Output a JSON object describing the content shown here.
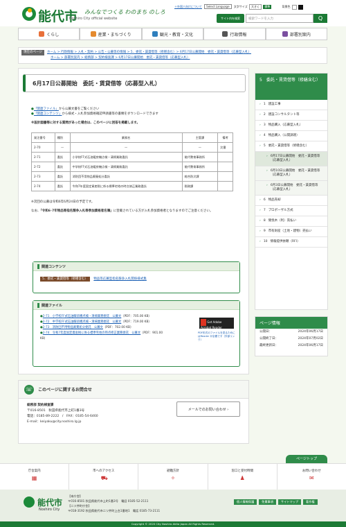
{
  "header": {
    "title": "能代市",
    "tagline": "みんなでつくる わのまち のしろ",
    "subtitle": "Noshiro City official website",
    "foreign": "＋外国人向けについて",
    "lang_select": "Select Language",
    "fontsize_label": "文字サイズ",
    "small": "大きく",
    "std": "標準",
    "bgcolor": "背景色",
    "sitewide": "サイト内を検索",
    "search_placeholder": "検索ワードを入力",
    "search_btn": "Q"
  },
  "nav": [
    {
      "label": "くらし",
      "color": "#e8703a"
    },
    {
      "label": "産業・まちづくり",
      "color": "#e58a2f"
    },
    {
      "label": "観光・教育・文化",
      "color": "#2f7fbd"
    },
    {
      "label": "行政情報",
      "color": "#555"
    },
    {
      "label": "部署別案内",
      "color": "#7b4fa0"
    }
  ],
  "breadcrumb": {
    "label": "現在のページ",
    "line1": "ホーム > 行政情報 > 入札・契約 > 公告・公募等の情報 > 5．委託・賃貸借等（修繕含む）> 6月17日公募開始　委託・賃貸借等（応募型入札）",
    "line2": "ホーム > 部署別案内 > 総務部 > 契約検査課 > 6月17日公募開始　委託・賃貸借等（応募型入札）"
  },
  "main": {
    "heading": "6月17日公募開始　委託・賃貸借等（応募型入札）",
    "p1a": "「関連ファイル」",
    "p1b": "から公募文書をご覧ください",
    "p2a": "「関連コンテンツ」",
    "p2b": "から様式・入札参加資格確認申請書等の書類をダウンロードできます",
    "bold": "※設計図書等に対する質問があった場合は、このページに回答を掲載します。",
    "table_headers": [
      "発注番号",
      "種別",
      "業務名",
      "主管課",
      "備考"
    ],
    "rows": [
      [
        "2-70",
        "—",
        "—",
        "—",
        "欠番"
      ],
      [
        "2-71",
        "委託",
        "小学校FF式石油暖房機点検・清掃業務委託",
        "能代教育事務所",
        ""
      ],
      [
        "2-72",
        "委託",
        "中学校FF式石油暖房機点検・清掃業務委託",
        "能代教育事務所",
        ""
      ],
      [
        "2-73",
        "委託",
        "消防団不用物品廃棄処分委託",
        "総合防災課",
        ""
      ],
      [
        "2-74",
        "委託",
        "令和7年度固定資産税に係る標準宅地の時点修正業務委託",
        "税務課",
        ""
      ]
    ],
    "note": "※次回の公募は令和6年6月24日の予定です。",
    "note2a": "なお、",
    "note2b": "「令和6･7年物品等指名競争入札等参加資格者名簿」",
    "note2c": "に登載されている方が入札参加資格者となりますのでご注意ください。"
  },
  "related_contents": {
    "title": "関連コンテンツ",
    "badge": "5．委託・賃貸借等（修繕含む）",
    "link": "物品等応募型指名競争入札関係様式集"
  },
  "related_files": {
    "title": "関連ファイル",
    "files": [
      {
        "name": "2-71　小学校FF式石油暖房機点検・清掃業務委託　公募文",
        "meta": "（PDF：705.00 KB）"
      },
      {
        "name": "2-72　中学校FF式石油暖房機点検・清掃業務委託　公募文",
        "meta": "（PDF：719.00 KB）"
      },
      {
        "name": "2-73　消防団不用物品廃棄処分委託　公募文",
        "meta": "（PDF：702.00 KB）"
      },
      {
        "name": "2-74　令和7年度固定資産税に係る標準宅地の時点修正業務委託　公募文",
        "meta": "（PDF：901.00 KB）"
      }
    ],
    "reader_alt": "Get Adobe Acrobat Reader",
    "reader_note": "PDF形式のファイルを見るためにはReader が必要です（外部リンク）"
  },
  "sidebar": {
    "head": "5　委託・賃貸借等（修繕含む）",
    "items": [
      {
        "n": "1",
        "label": "建設工事",
        "sub": false,
        "sel": false
      },
      {
        "n": "2",
        "label": "建設コンサルタント等",
        "sub": false,
        "sel": false
      },
      {
        "n": "3",
        "label": "物品購入（応募型入札）",
        "sub": false,
        "sel": false
      },
      {
        "n": "4",
        "label": "物品購入（公開調達）",
        "sub": false,
        "sel": false
      },
      {
        "n": "5",
        "label": "委託・賃貸借等（修繕含む）",
        "sub": false,
        "sel": false
      },
      {
        "n": "",
        "label": "6月17日公募開始　委託・賃貸借等（応募型入札）",
        "sub": true,
        "sel": true
      },
      {
        "n": "",
        "label": "6月10日公募開始　委託・賃貸借等（応募型入札）",
        "sub": true,
        "sel": false
      },
      {
        "n": "",
        "label": "6月3日公募開始　委託・賃貸借等（応募型入札）",
        "sub": true,
        "sel": false
      },
      {
        "n": "6",
        "label": "物品売却",
        "sub": false,
        "sel": false
      },
      {
        "n": "7",
        "label": "プロポーザル方式",
        "sub": false,
        "sel": false
      },
      {
        "n": "8",
        "label": "間伐木（利）売払い",
        "sub": false,
        "sel": false
      },
      {
        "n": "9",
        "label": "市有財産（土地・建物）売払い",
        "sub": false,
        "sel": false
      },
      {
        "n": "10",
        "label": "情報提供依頼（RFI）",
        "sub": false,
        "sel": false
      }
    ]
  },
  "pageinfo": {
    "title": "ページ情報",
    "rows": [
      [
        "公開日：",
        "2024年06月17日"
      ],
      [
        "公開終了日：",
        "2024年07月02日"
      ],
      [
        "最終更新日：",
        "2024年06月17日"
      ]
    ]
  },
  "contact": {
    "title": "このページに関するお問合せ",
    "dept": "総務部 契約検査課",
    "addr": "〒016-8501　秋田県能代市上町1番3号",
    "tel": "電話：0185-89-2222　/　FAX：0185-54-6460",
    "email": "E-mail：keiyaku@city.noshiro.lg.jp",
    "mail_btn": "メールでのお問い合わせ ›"
  },
  "pagetop": "ページトップ",
  "footer": {
    "items": [
      "庁舎案内",
      "市へのアクセス",
      "避難方針",
      "窓口と受付時間",
      "お問い合わせ"
    ],
    "title": "能代市",
    "sub": "Noshiro City",
    "addr1": "【本庁舎】",
    "addr2": "〒016-8501 秋田県能代市上町1番3号　電話 0185-52-2111",
    "addr3": "【二ツ井町庁舎】",
    "addr4": "〒018-3192 秋田県能代市二ツ井町上台1番地1　電話 0185-73-2111",
    "links": [
      "個人情報保護",
      "免責事項",
      "サイトマップ",
      "著作権"
    ],
    "copy": "Copyright © 2020 City Noshiro Akita Japan All Rights Reserved."
  }
}
